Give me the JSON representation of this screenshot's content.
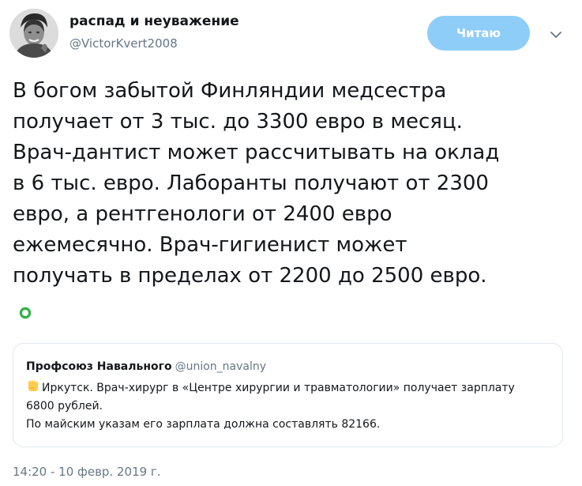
{
  "tweet": {
    "author_name": "распад и неуважение",
    "author_handle": "@VictorKvert2008",
    "follow_label": "Читаю",
    "text_lines": [
      "В богом забытой Финляндии медсестра",
      "получает от 3 тыс. до 3300 евро в месяц.",
      "Врач-дантист может рассчитывать на оклад",
      "в 6 тыс. евро. Лаборанты получают от 2300",
      "евро, а рентгенологи от 2400 евро",
      "ежемесячно. Врач-гигиенист может",
      "получать в пределах от 2200 до 2500 евро."
    ],
    "timestamp": "14:20 - 10 февр. 2019 г.",
    "icons": {
      "caret": "chevron-down-icon",
      "emoji": "green-circle-emoji-icon"
    }
  },
  "quote": {
    "author_name": "Профсоюз Навального",
    "author_handle": "@union_navalny",
    "icon": "raised-fist-emoji-icon",
    "lines": [
      "Иркутск. Врач-хирург в «Центре хирургии и травматологии» получает зарплату",
      "6800 рублей.",
      "По майским указам его зарплата должна составлять 82166."
    ]
  },
  "colors": {
    "text": "#14171a",
    "secondary": "#657786",
    "follow_button": "#8ecdf8",
    "border": "#e1e8ed",
    "emoji_green": "#2fb344"
  }
}
